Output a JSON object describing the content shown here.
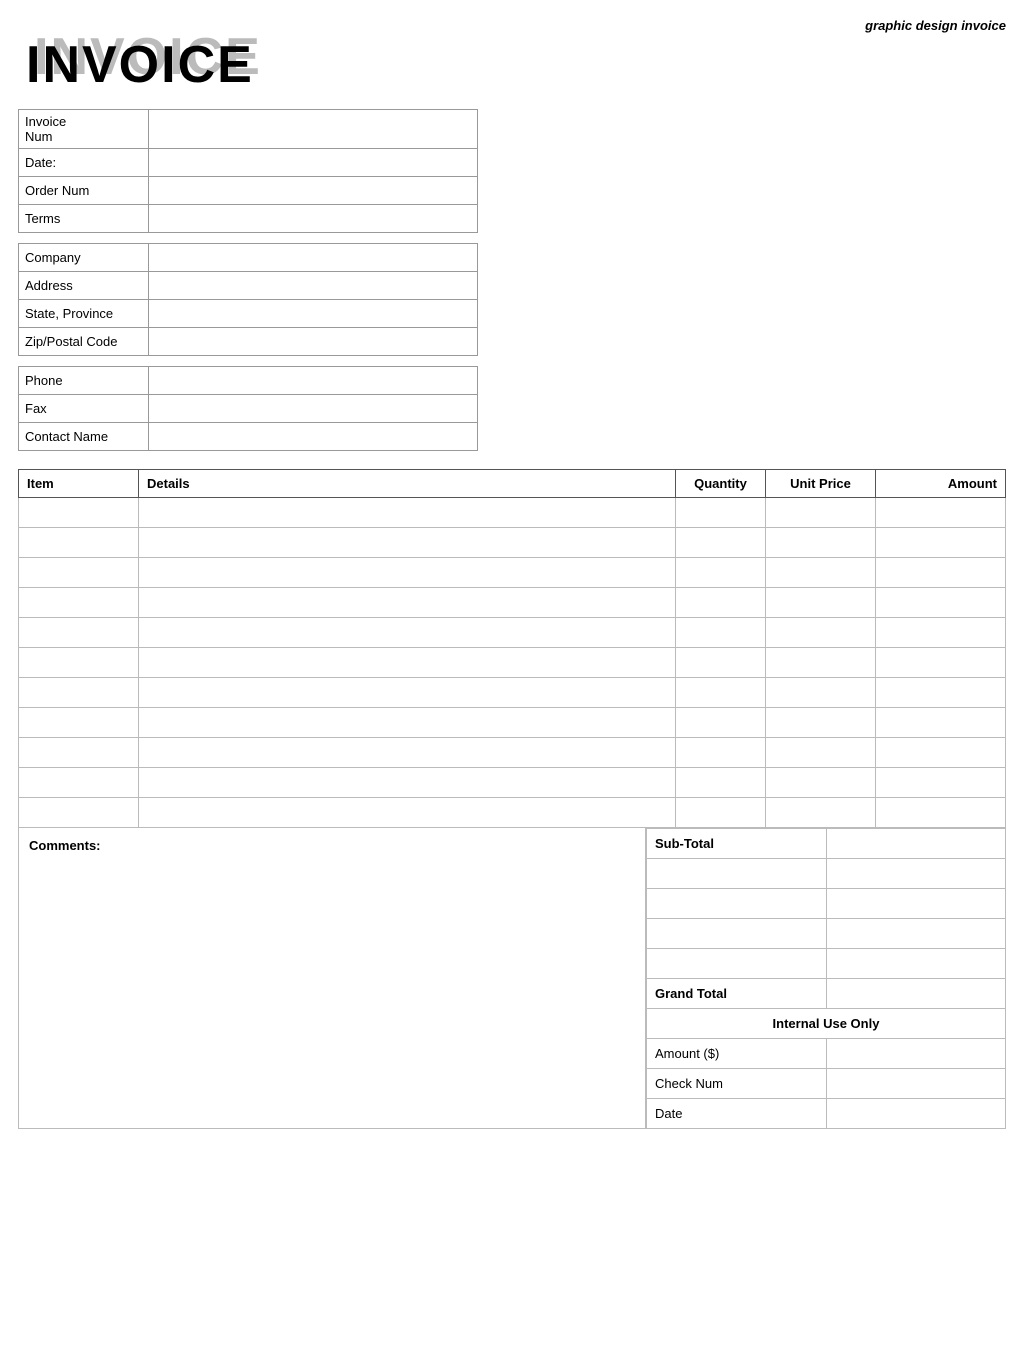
{
  "header": {
    "subtitle": "graphic design invoice"
  },
  "invoice_title": "INVOICE",
  "invoice_info": {
    "fields": [
      {
        "label": "Invoice Num",
        "value": ""
      },
      {
        "label": "Date:",
        "value": ""
      },
      {
        "label": "Order Num",
        "value": ""
      },
      {
        "label": "Terms",
        "value": ""
      }
    ]
  },
  "company_info": {
    "fields": [
      {
        "label": "Company",
        "value": ""
      },
      {
        "label": "Address",
        "value": ""
      },
      {
        "label": "State, Province",
        "value": ""
      },
      {
        "label": "Zip/Postal Code",
        "value": ""
      }
    ]
  },
  "contact_info": {
    "fields": [
      {
        "label": "Phone",
        "value": ""
      },
      {
        "label": "Fax",
        "value": ""
      },
      {
        "label": "Contact Name",
        "value": ""
      }
    ]
  },
  "items_table": {
    "headers": {
      "item": "Item",
      "details": "Details",
      "quantity": "Quantity",
      "unit_price": "Unit Price",
      "amount": "Amount"
    },
    "rows": 11
  },
  "comments": {
    "label": "Comments:"
  },
  "totals": {
    "subtotal_label": "Sub-Total",
    "subtotal_value": "",
    "extra_rows": 4,
    "grand_total_label": "Grand Total",
    "grand_total_value": "",
    "internal_header": "Internal Use Only",
    "internal_fields": [
      {
        "label": "Amount ($)",
        "value": ""
      },
      {
        "label": "Check Num",
        "value": ""
      },
      {
        "label": "Date",
        "value": ""
      }
    ]
  }
}
